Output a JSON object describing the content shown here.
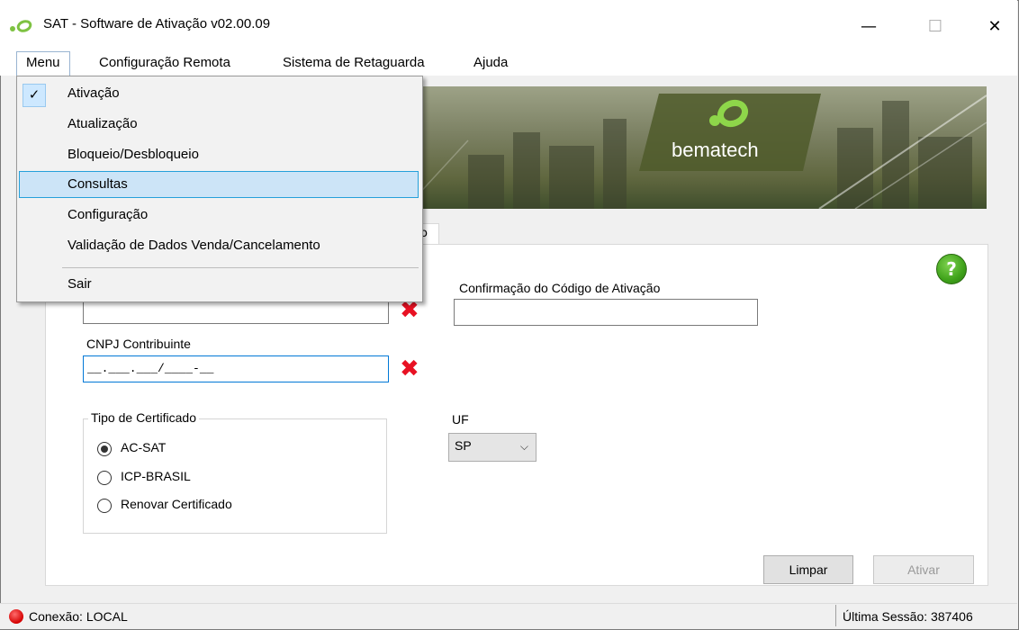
{
  "window": {
    "title": "SAT - Software de Ativação v02.00.09",
    "minimize_glyph": "—",
    "maximize_glyph": "☐",
    "close_glyph": "✕"
  },
  "menubar": {
    "items": [
      "Menu",
      "Configuração Remota",
      "Sistema de Retaguarda",
      "Ajuda"
    ]
  },
  "dropdown": {
    "checked_item": "Ativação",
    "items": [
      "Ativação",
      "Atualização",
      "Bloqueio/Desbloqueio",
      "Consultas",
      "Configuração",
      "Validação de Dados Venda/Cancelamento",
      "Sair"
    ],
    "highlighted": "Consultas",
    "check_glyph": "✓"
  },
  "banner": {
    "brand": "bematech"
  },
  "tab": {
    "partial_label": "o"
  },
  "form": {
    "confirm_code_label": "Confirmação do Código de Ativação",
    "confirm_code_value": "",
    "activation_code_value": "",
    "cnpj_label": "CNPJ Contribuinte",
    "cnpj_value": "__.___.___/____-__",
    "invalid_glyph": "✖",
    "help_glyph": "?",
    "cert_group_label": "Tipo de Certificado",
    "cert_options": [
      "AC-SAT",
      "ICP-BRASIL",
      "Renovar Certificado"
    ],
    "cert_selected": "AC-SAT",
    "uf_label": "UF",
    "uf_value": "SP",
    "uf_chevron": "⌵",
    "clear_button": "Limpar",
    "activate_button": "Ativar"
  },
  "status": {
    "connection": "Conexão: LOCAL",
    "last_session": "Última Sessão: 387406"
  },
  "colors": {
    "accent": "#0078d7",
    "error": "#e81123",
    "help_green": "#3fa21a",
    "menu_highlight": "#cce4f7",
    "brand_green": "#7ec242"
  }
}
